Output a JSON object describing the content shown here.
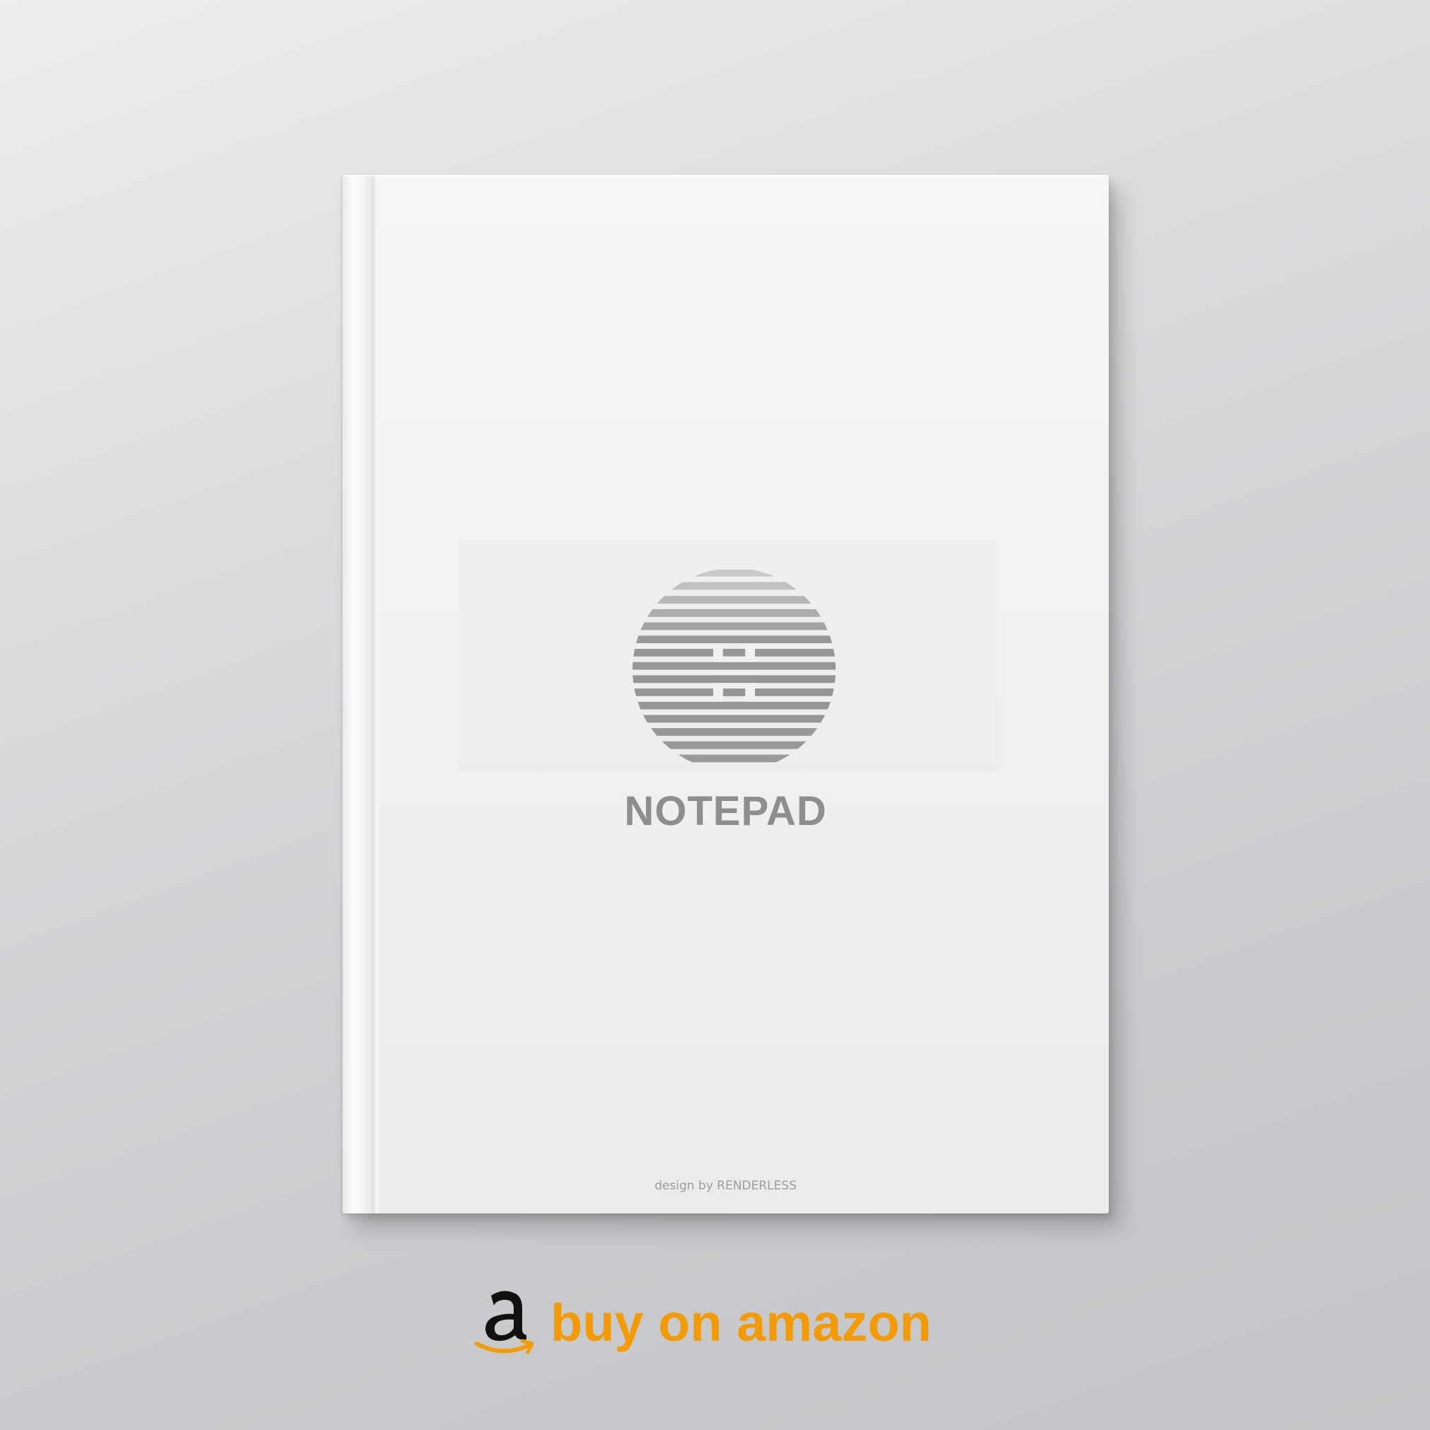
{
  "book": {
    "title": "NOTEPAD",
    "credit": "design by RENDERLESS",
    "logo_icon": "striped-circle-logo",
    "logo_color": "#9a9a9a",
    "title_color": "#8e8e8e"
  },
  "buy": {
    "label": "buy on amazon",
    "icon": "amazon-icon",
    "accent": "#f39b05"
  }
}
